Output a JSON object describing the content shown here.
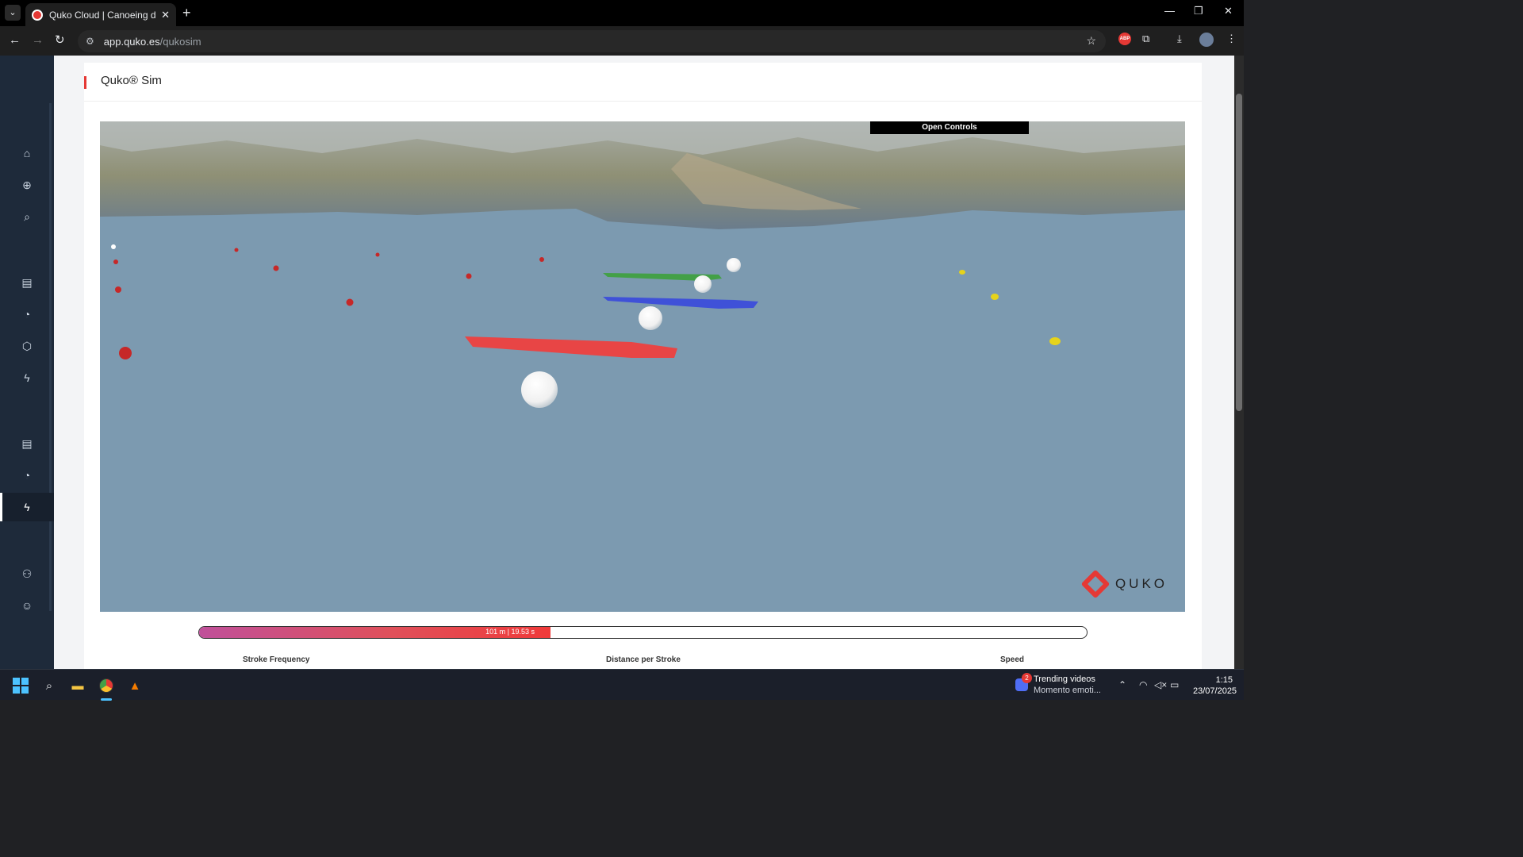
{
  "browser": {
    "tab_title": "Quko Cloud | Canoeing data an",
    "url_host": "app.quko.es",
    "url_path": "/qukosim"
  },
  "page": {
    "title": "Quko® Sim",
    "open_controls": "Open Controls",
    "logo_text": "QUKO",
    "progress": {
      "label": "101 m | 19.53 s",
      "fraction": 0.396
    },
    "metrics": [
      "Stroke Frequency",
      "Distance per Stroke",
      "Speed"
    ]
  },
  "sidebar": {
    "items": [
      "home-icon",
      "plus-circle-icon",
      "search-icon",
      "document-icon",
      "pie-chart-icon",
      "cube-icon",
      "bolt-icon",
      "document-icon",
      "pie-chart-icon",
      "bolt-icon",
      "users-icon",
      "user-icon"
    ],
    "active_index": 9
  },
  "taskbar": {
    "news_title": "Trending videos",
    "news_subtitle": "Momento emoti...",
    "news_badge": "2",
    "time": "1:15",
    "date": "23/07/2025"
  },
  "colors": {
    "accent": "#e53935",
    "water": "#7c9ab0",
    "sidebar": "#1e2a3a"
  }
}
